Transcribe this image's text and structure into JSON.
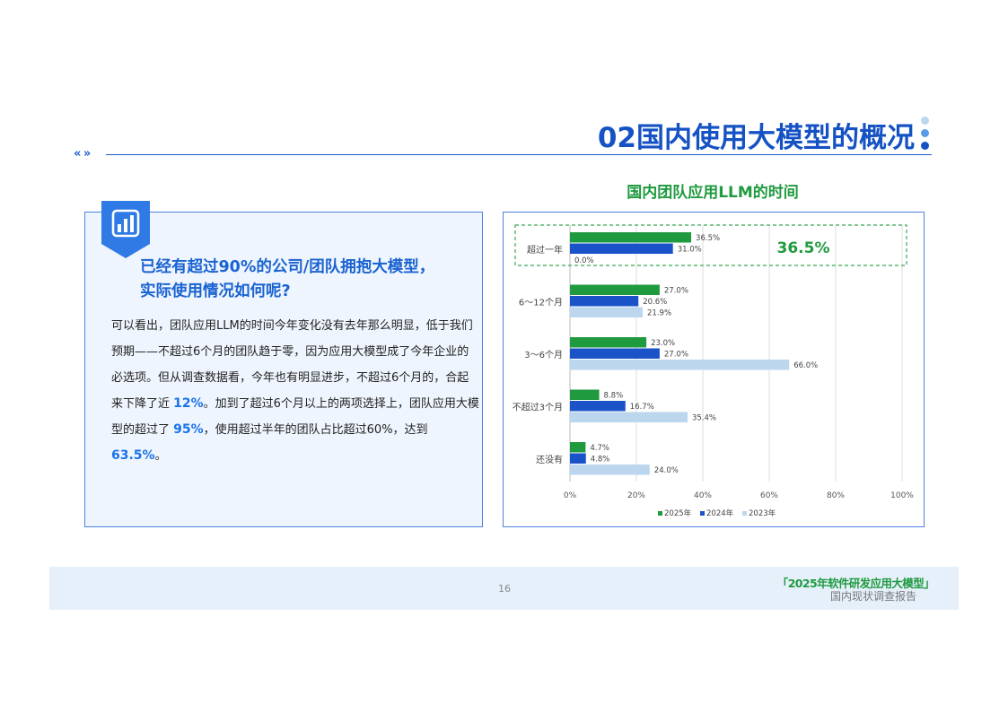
{
  "page": {
    "title": "02国内使用大模型的概况",
    "colors": {
      "primary": "#1552c4",
      "green": "#1f9a3f",
      "panel_bg": "#eff5fe"
    }
  },
  "left_panel": {
    "badge_icon": "bar-chart-icon",
    "heading_line1": "已经有超过90%的公司/团队拥抱大模型，",
    "heading_line2": "实际使用情况如何呢?",
    "body": {
      "p1": "可以看出，团队应用LLM的时间今年变化没有去年那么明显，低于我们预期——不超过6个月的团队趋于零，因为应用大模型成了今年企业的必选项。但从调查数据看，今年也有明显进步，不超过6个月的，合起来下降了近 ",
      "h1": "12%",
      "p2": "。加到了超过6个月以上的两项选择上，团队应用大模型的超过了 ",
      "h2": "95%",
      "p3": "，使用超过半年的团队占比超过60%，达到 ",
      "h3": "63.5%",
      "p4": "。"
    }
  },
  "chart_data": {
    "type": "bar",
    "orientation": "horizontal",
    "title": "国内团队应用LLM的时间",
    "categories": [
      "超过一年",
      "6～12个月",
      "3～6个月",
      "不超过3个月",
      "还没有"
    ],
    "series": [
      {
        "name": "2025年",
        "color": "#1f9a3f",
        "values": [
          36.5,
          27.0,
          23.0,
          8.8,
          4.7
        ],
        "labels": [
          "36.5%",
          "27.0%",
          "23.0%",
          "8.8%",
          "4.7%"
        ]
      },
      {
        "name": "2024年",
        "color": "#1a53c8",
        "values": [
          31.0,
          20.6,
          27.0,
          16.7,
          4.8
        ],
        "labels": [
          "31.0%",
          "20.6%",
          "27.0%",
          "16.7%",
          "4.8%"
        ]
      },
      {
        "name": "2023年",
        "color": "#bcd6ee",
        "values": [
          0.0,
          21.9,
          66.0,
          35.4,
          24.0
        ],
        "labels": [
          "0.0%",
          "21.9%",
          "66.0%",
          "35.4%",
          "24.0%"
        ]
      }
    ],
    "xlim": [
      0,
      100
    ],
    "x_ticks": [
      "0%",
      "20%",
      "40%",
      "60%",
      "80%",
      "100%"
    ],
    "grid": true,
    "legend": "bottom",
    "highlight": {
      "category": "超过一年",
      "text": "36.5%"
    }
  },
  "footer": {
    "page_number": "16",
    "brand": "「2025年软件研发应用大模型」",
    "subtitle": "国内现状调查报告"
  }
}
